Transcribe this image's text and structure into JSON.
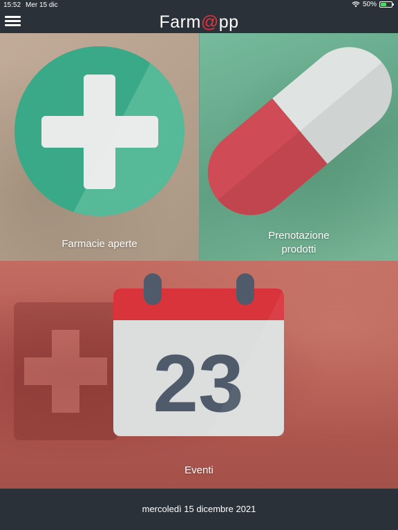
{
  "status_bar": {
    "time": "15:52",
    "date": "Mer 15 dic",
    "battery": "50%",
    "icons": [
      "wifi-icon",
      "battery-icon"
    ]
  },
  "header": {
    "brand_prefix": "Farm",
    "brand_at": "@",
    "brand_suffix": "pp",
    "menu_icon": "hamburger-menu-icon",
    "accent_color": "#e5323c"
  },
  "tiles": [
    {
      "label": "Farmacie aperte",
      "icon": "pharmacy-cross-icon",
      "color": "#3fae89"
    },
    {
      "label_line1": "Prenotazione",
      "label_line2": "prodotti",
      "icon": "pill-capsule-icon",
      "color": "#cf4b55"
    },
    {
      "label": "Eventi",
      "icon": "calendar-icon",
      "calendar_day": "23",
      "color": "#d9343c"
    }
  ],
  "footer": {
    "date": "mercoledì 15 dicembre 2021"
  }
}
